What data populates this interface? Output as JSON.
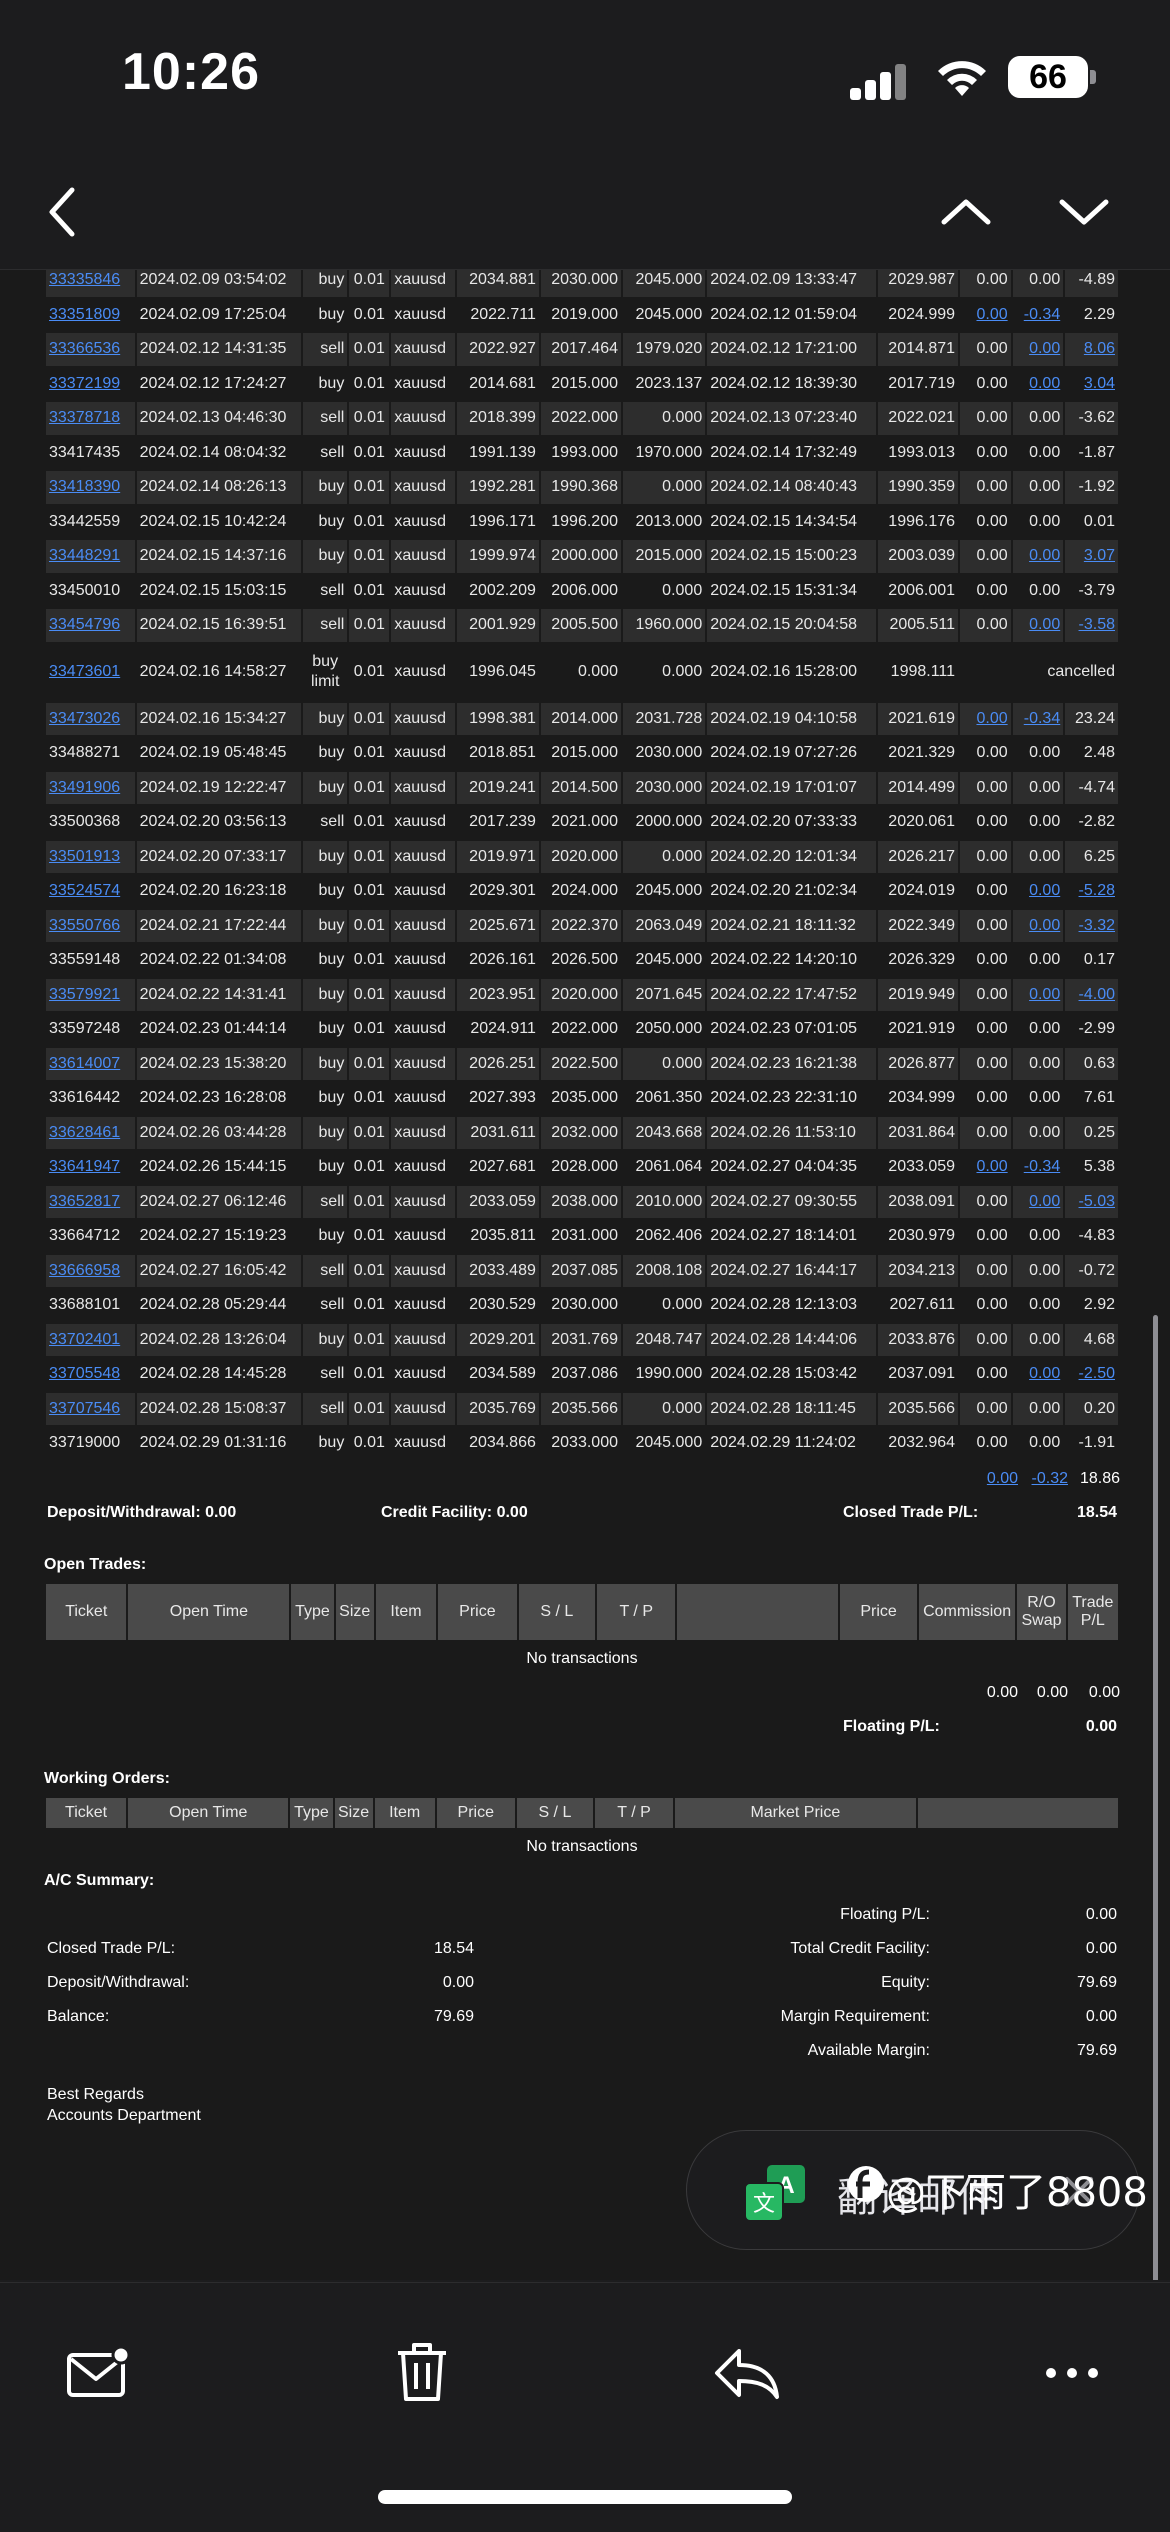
{
  "status": {
    "time": "10:26",
    "battery": "66"
  },
  "history": [
    [
      "33335846",
      "2024.02.09 03:54:02",
      "buy",
      "0.01",
      "xauusd",
      "2034.881",
      "2030.000",
      "2045.000",
      "2024.02.09 13:33:47",
      "2029.987",
      "0.00",
      "0.00",
      "-4.89"
    ],
    [
      "33351809",
      "2024.02.09 17:25:04",
      "buy",
      "0.01",
      "xauusd",
      "2022.711",
      "2019.000",
      "2045.000",
      "2024.02.12 01:59:04",
      "2024.999",
      "0.00",
      "-0.34",
      "2.29"
    ],
    [
      "33366536",
      "2024.02.12 14:31:35",
      "sell",
      "0.01",
      "xauusd",
      "2022.927",
      "2017.464",
      "1979.020",
      "2024.02.12 17:21:00",
      "2014.871",
      "0.00",
      "0.00",
      "8.06"
    ],
    [
      "33372199",
      "2024.02.12 17:24:27",
      "buy",
      "0.01",
      "xauusd",
      "2014.681",
      "2015.000",
      "2023.137",
      "2024.02.12 18:39:30",
      "2017.719",
      "0.00",
      "0.00",
      "3.04"
    ],
    [
      "33378718",
      "2024.02.13 04:46:30",
      "sell",
      "0.01",
      "xauusd",
      "2018.399",
      "2022.000",
      "0.000",
      "2024.02.13 07:23:40",
      "2022.021",
      "0.00",
      "0.00",
      "-3.62"
    ],
    [
      "33417435",
      "2024.02.14 08:04:32",
      "sell",
      "0.01",
      "xauusd",
      "1991.139",
      "1993.000",
      "1970.000",
      "2024.02.14 17:32:49",
      "1993.013",
      "0.00",
      "0.00",
      "-1.87"
    ],
    [
      "33418390",
      "2024.02.14 08:26:13",
      "buy",
      "0.01",
      "xauusd",
      "1992.281",
      "1990.368",
      "0.000",
      "2024.02.14 08:40:43",
      "1990.359",
      "0.00",
      "0.00",
      "-1.92"
    ],
    [
      "33442559",
      "2024.02.15 10:42:24",
      "buy",
      "0.01",
      "xauusd",
      "1996.171",
      "1996.200",
      "2013.000",
      "2024.02.15 14:34:54",
      "1996.176",
      "0.00",
      "0.00",
      "0.01"
    ],
    [
      "33448291",
      "2024.02.15 14:37:16",
      "buy",
      "0.01",
      "xauusd",
      "1999.974",
      "2000.000",
      "2015.000",
      "2024.02.15 15:00:23",
      "2003.039",
      "0.00",
      "0.00",
      "3.07"
    ],
    [
      "33450010",
      "2024.02.15 15:03:15",
      "sell",
      "0.01",
      "xauusd",
      "2002.209",
      "2006.000",
      "0.000",
      "2024.02.15 15:31:34",
      "2006.001",
      "0.00",
      "0.00",
      "-3.79"
    ],
    [
      "33454796",
      "2024.02.15 16:39:51",
      "sell",
      "0.01",
      "xauusd",
      "2001.929",
      "2005.500",
      "1960.000",
      "2024.02.15 20:04:58",
      "2005.511",
      "0.00",
      "0.00",
      "-3.58"
    ],
    [
      "33473601",
      "2024.02.16 14:58:27",
      "buy limit",
      "0.01",
      "xauusd",
      "1996.045",
      "0.000",
      "0.000",
      "2024.02.16 15:28:00",
      "1998.111",
      "",
      "",
      "cancelled"
    ],
    [
      "33473026",
      "2024.02.16 15:34:27",
      "buy",
      "0.01",
      "xauusd",
      "1998.381",
      "2014.000",
      "2031.728",
      "2024.02.19 04:10:58",
      "2021.619",
      "0.00",
      "-0.34",
      "23.24"
    ],
    [
      "33488271",
      "2024.02.19 05:48:45",
      "buy",
      "0.01",
      "xauusd",
      "2018.851",
      "2015.000",
      "2030.000",
      "2024.02.19 07:27:26",
      "2021.329",
      "0.00",
      "0.00",
      "2.48"
    ],
    [
      "33491906",
      "2024.02.19 12:22:47",
      "buy",
      "0.01",
      "xauusd",
      "2019.241",
      "2014.500",
      "2030.000",
      "2024.02.19 17:01:07",
      "2014.499",
      "0.00",
      "0.00",
      "-4.74"
    ],
    [
      "33500368",
      "2024.02.20 03:56:13",
      "sell",
      "0.01",
      "xauusd",
      "2017.239",
      "2021.000",
      "2000.000",
      "2024.02.20 07:33:33",
      "2020.061",
      "0.00",
      "0.00",
      "-2.82"
    ],
    [
      "33501913",
      "2024.02.20 07:33:17",
      "buy",
      "0.01",
      "xauusd",
      "2019.971",
      "2020.000",
      "0.000",
      "2024.02.20 12:01:34",
      "2026.217",
      "0.00",
      "0.00",
      "6.25"
    ],
    [
      "33524574",
      "2024.02.20 16:23:18",
      "buy",
      "0.01",
      "xauusd",
      "2029.301",
      "2024.000",
      "2045.000",
      "2024.02.20 21:02:34",
      "2024.019",
      "0.00",
      "0.00",
      "-5.28"
    ],
    [
      "33550766",
      "2024.02.21 17:22:44",
      "buy",
      "0.01",
      "xauusd",
      "2025.671",
      "2022.370",
      "2063.049",
      "2024.02.21 18:11:32",
      "2022.349",
      "0.00",
      "0.00",
      "-3.32"
    ],
    [
      "33559148",
      "2024.02.22 01:34:08",
      "buy",
      "0.01",
      "xauusd",
      "2026.161",
      "2026.500",
      "2045.000",
      "2024.02.22 14:20:10",
      "2026.329",
      "0.00",
      "0.00",
      "0.17"
    ],
    [
      "33579921",
      "2024.02.22 14:31:41",
      "buy",
      "0.01",
      "xauusd",
      "2023.951",
      "2020.000",
      "2071.645",
      "2024.02.22 17:47:52",
      "2019.949",
      "0.00",
      "0.00",
      "-4.00"
    ],
    [
      "33597248",
      "2024.02.23 01:44:14",
      "buy",
      "0.01",
      "xauusd",
      "2024.911",
      "2022.000",
      "2050.000",
      "2024.02.23 07:01:05",
      "2021.919",
      "0.00",
      "0.00",
      "-2.99"
    ],
    [
      "33614007",
      "2024.02.23 15:38:20",
      "buy",
      "0.01",
      "xauusd",
      "2026.251",
      "2022.500",
      "0.000",
      "2024.02.23 16:21:38",
      "2026.877",
      "0.00",
      "0.00",
      "0.63"
    ],
    [
      "33616442",
      "2024.02.23 16:28:08",
      "buy",
      "0.01",
      "xauusd",
      "2027.393",
      "2035.000",
      "2061.350",
      "2024.02.23 22:31:10",
      "2034.999",
      "0.00",
      "0.00",
      "7.61"
    ],
    [
      "33628461",
      "2024.02.26 03:44:28",
      "buy",
      "0.01",
      "xauusd",
      "2031.611",
      "2032.000",
      "2043.668",
      "2024.02.26 11:53:10",
      "2031.864",
      "0.00",
      "0.00",
      "0.25"
    ],
    [
      "33641947",
      "2024.02.26 15:44:15",
      "buy",
      "0.01",
      "xauusd",
      "2027.681",
      "2028.000",
      "2061.064",
      "2024.02.27 04:04:35",
      "2033.059",
      "0.00",
      "-0.34",
      "5.38"
    ],
    [
      "33652817",
      "2024.02.27 06:12:46",
      "sell",
      "0.01",
      "xauusd",
      "2033.059",
      "2038.000",
      "2010.000",
      "2024.02.27 09:30:55",
      "2038.091",
      "0.00",
      "0.00",
      "-5.03"
    ],
    [
      "33664712",
      "2024.02.27 15:19:23",
      "buy",
      "0.01",
      "xauusd",
      "2035.811",
      "2031.000",
      "2062.406",
      "2024.02.27 18:14:01",
      "2030.979",
      "0.00",
      "0.00",
      "-4.83"
    ],
    [
      "33666958",
      "2024.02.27 16:05:42",
      "sell",
      "0.01",
      "xauusd",
      "2033.489",
      "2037.085",
      "2008.108",
      "2024.02.27 16:44:17",
      "2034.213",
      "0.00",
      "0.00",
      "-0.72"
    ],
    [
      "33688101",
      "2024.02.28 05:29:44",
      "sell",
      "0.01",
      "xauusd",
      "2030.529",
      "2030.000",
      "0.000",
      "2024.02.28 12:13:03",
      "2027.611",
      "0.00",
      "0.00",
      "2.92"
    ],
    [
      "33702401",
      "2024.02.28 13:26:04",
      "buy",
      "0.01",
      "xauusd",
      "2029.201",
      "2031.769",
      "2048.747",
      "2024.02.28 14:44:06",
      "2033.876",
      "0.00",
      "0.00",
      "4.68"
    ],
    [
      "33705548",
      "2024.02.28 14:45:28",
      "sell",
      "0.01",
      "xauusd",
      "2034.589",
      "2037.086",
      "1990.000",
      "2024.02.28 15:03:42",
      "2037.091",
      "0.00",
      "0.00",
      "-2.50"
    ],
    [
      "33707546",
      "2024.02.28 15:08:37",
      "sell",
      "0.01",
      "xauusd",
      "2035.769",
      "2035.566",
      "0.000",
      "2024.02.28 18:11:45",
      "2035.566",
      "0.00",
      "0.00",
      "0.20"
    ],
    [
      "33719000",
      "2024.02.29 01:31:16",
      "buy",
      "0.01",
      "xauusd",
      "2034.866",
      "2033.000",
      "2045.000",
      "2024.02.29 11:24:02",
      "2032.964",
      "0.00",
      "0.00",
      "-1.91"
    ]
  ],
  "links": {
    "0": [
      0
    ],
    "1": [
      0,
      10,
      11
    ],
    "2": [
      0,
      11,
      12
    ],
    "3": [
      0,
      11,
      12
    ],
    "4": [
      0
    ],
    "6": [
      0
    ],
    "8": [
      0,
      11,
      12
    ],
    "10": [
      0,
      11,
      12
    ],
    "11": [
      0
    ],
    "12": [
      0,
      10,
      11
    ],
    "14": [
      0
    ],
    "16": [
      0
    ],
    "17": [
      0,
      11,
      12
    ],
    "18": [
      0,
      11,
      12
    ],
    "20": [
      0,
      11,
      12
    ],
    "22": [
      0
    ],
    "24": [
      0
    ],
    "25": [
      0,
      10,
      11
    ],
    "26": [
      0,
      11,
      12
    ],
    "28": [
      0
    ],
    "30": [
      0
    ],
    "31": [
      0,
      11,
      12
    ],
    "32": [
      0
    ]
  },
  "history_totals": {
    "commission": "0.00",
    "swap": "-0.32",
    "profit": "18.86"
  },
  "history_summary": {
    "deposit_label": "Deposit/Withdrawal: 0.00",
    "credit_label": "Credit Facility: 0.00",
    "closed_label": "Closed Trade P/L:",
    "closed_value": "18.54"
  },
  "open_trades": {
    "title": "Open Trades:",
    "headers": [
      "Ticket",
      "Open Time",
      "Type",
      "Size",
      "Item",
      "Price",
      "S / L",
      "T / P",
      "",
      "Price",
      "Commission",
      "R/O Swap",
      "Trade P/L"
    ],
    "empty": "No transactions",
    "totals": [
      "0.00",
      "0.00",
      "0.00"
    ],
    "floating_label": "Floating P/L:",
    "floating_value": "0.00"
  },
  "working_orders": {
    "title": "Working Orders:",
    "headers": [
      "Ticket",
      "Open Time",
      "Type",
      "Size",
      "Item",
      "Price",
      "S / L",
      "T / P",
      "Market Price",
      ""
    ],
    "empty": "No transactions"
  },
  "ac_summary": {
    "title": "A/C Summary:",
    "floating_label": "Floating P/L:",
    "floating_value": "0.00",
    "closed_label": "Closed Trade P/L:",
    "closed_value": "18.54",
    "credit_label": "Total Credit Facility:",
    "credit_value": "0.00",
    "deposit_label": "Deposit/Withdrawal:",
    "deposit_value": "0.00",
    "equity_label": "Equity:",
    "equity_value": "79.69",
    "balance_label": "Balance:",
    "balance_value": "79.69",
    "margin_label": "Margin Requirement:",
    "margin_value": "0.00",
    "available_label": "Available Margin:",
    "available_value": "79.69"
  },
  "signature": {
    "line1": "Best Regards",
    "line2": "Accounts Department"
  },
  "translate": {
    "label": "翻译邮件"
  },
  "watermark": "@下雨了8808",
  "colors": {
    "background": "#1a1a1a",
    "link": "#4a8cf5",
    "row_alt": "#2d2d2d",
    "header": "#4a4a4a"
  }
}
